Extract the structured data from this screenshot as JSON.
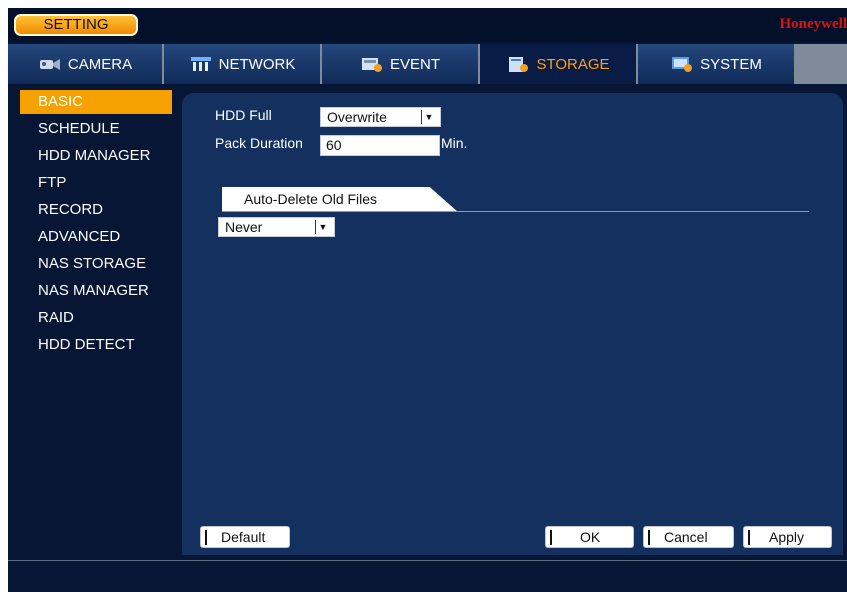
{
  "title_bar": {
    "setting_label": "SETTING",
    "brand": "Honeywell"
  },
  "tabs": [
    {
      "label": "CAMERA",
      "icon": "camera-icon",
      "active": false
    },
    {
      "label": "NETWORK",
      "icon": "network-icon",
      "active": false
    },
    {
      "label": "EVENT",
      "icon": "event-icon",
      "active": false
    },
    {
      "label": "STORAGE",
      "icon": "storage-icon",
      "active": true
    },
    {
      "label": "SYSTEM",
      "icon": "system-icon",
      "active": false
    }
  ],
  "menu": [
    {
      "label": "BASIC",
      "active": true
    },
    {
      "label": "SCHEDULE"
    },
    {
      "label": "HDD MANAGER"
    },
    {
      "label": "FTP"
    },
    {
      "label": "RECORD"
    },
    {
      "label": "ADVANCED"
    },
    {
      "label": "NAS STORAGE"
    },
    {
      "label": "NAS MANAGER"
    },
    {
      "label": "RAID"
    },
    {
      "label": "HDD DETECT"
    }
  ],
  "form": {
    "hdd_full_label": "HDD Full",
    "hdd_full_value": "Overwrite",
    "pack_duration_label": "Pack Duration",
    "pack_duration_value": "60",
    "pack_duration_unit": "Min.",
    "auto_delete_tab": "Auto-Delete Old Files",
    "auto_delete_value": "Never"
  },
  "buttons": {
    "default": "Default",
    "ok": "OK",
    "cancel": "Cancel",
    "apply": "Apply"
  },
  "colors": {
    "accent": "#F7A100",
    "active_tab_text": "#FF9D1C",
    "background": "#071634",
    "panel": "#13305E",
    "brand": "#E01010"
  }
}
